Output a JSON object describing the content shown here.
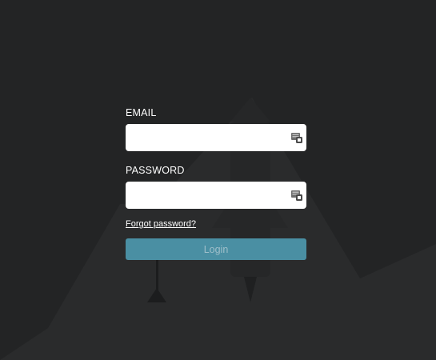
{
  "form": {
    "email_label": "EMAIL",
    "email_value": "",
    "password_label": "PASSWORD",
    "password_value": "",
    "forgot_password": "Forgot password?",
    "login_label": "Login"
  },
  "icons": {
    "email_autofill": "password-manager-autofill-icon",
    "password_autofill": "password-manager-autofill-icon"
  },
  "colors": {
    "background": "#232425",
    "login_button": "#4a8fa3",
    "login_button_text": "#9fbfca"
  }
}
